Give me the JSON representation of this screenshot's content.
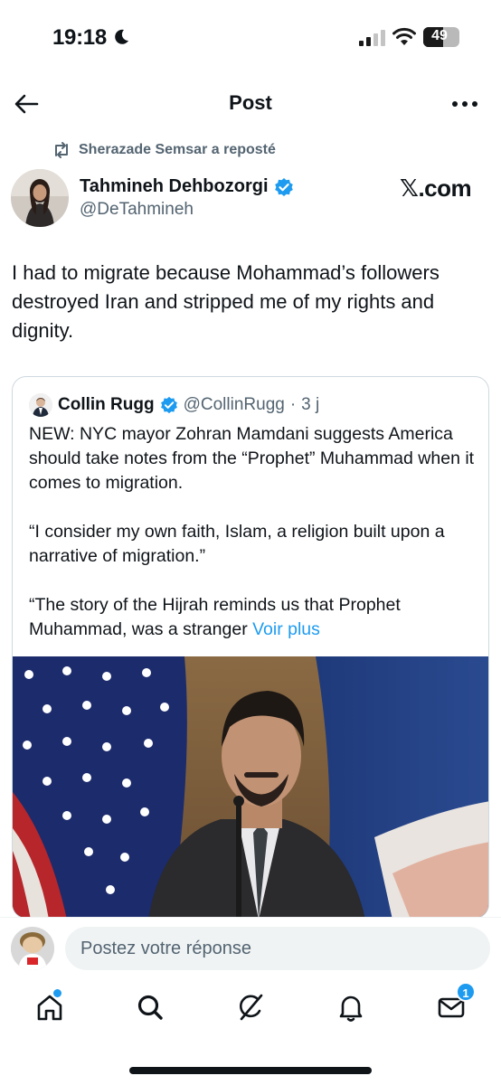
{
  "status": {
    "time": "19:18",
    "battery": "49",
    "battery_fill_percent": 49
  },
  "header": {
    "title": "Post"
  },
  "repost": {
    "text": "Sherazade Semsar a reposté"
  },
  "post": {
    "author_name": "Tahmineh Dehbozorgi",
    "author_handle": "@DeTahmineh",
    "brand_label": "𝕏.com",
    "text": "I had to migrate because Mohammad’s followers destroyed Iran and stripped me of my rights and dignity."
  },
  "quote": {
    "author_name": "Collin Rugg",
    "author_handle": "@CollinRugg",
    "separator": " · ",
    "age": "3 j",
    "paragraph1": "NEW: NYC mayor Zohran Mamdani suggests America should take notes from the “Prophet” Muhammad when it comes to migration.",
    "paragraph2": "“I consider my own faith, Islam, a religion built upon a narrative of migration.”",
    "paragraph3": "“The story of the Hijrah reminds us that Prophet Muhammad, was a stranger ",
    "more_link": "Voir plus"
  },
  "reply": {
    "placeholder": "Postez votre réponse"
  },
  "tabs": {
    "messages_badge": "1"
  },
  "colors": {
    "accent": "#1d9bf0",
    "text_primary": "#0f1419",
    "text_secondary": "#536471"
  },
  "icons": [
    "moon-icon",
    "signal-icon",
    "wifi-icon",
    "battery-icon",
    "back-arrow-icon",
    "more-icon",
    "repost-icon",
    "verified-icon",
    "home-icon",
    "search-icon",
    "grok-icon",
    "notifications-icon",
    "messages-icon"
  ]
}
